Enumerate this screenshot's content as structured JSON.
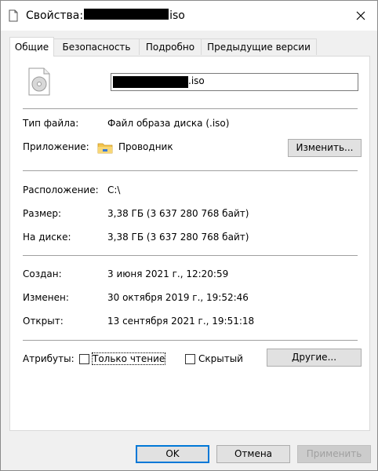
{
  "window": {
    "title_prefix": "Свойства:",
    "title_suffix": "iso"
  },
  "tabs": [
    {
      "label": "Общие",
      "active": true
    },
    {
      "label": "Безопасность",
      "active": false
    },
    {
      "label": "Подробно",
      "active": false
    },
    {
      "label": "Предыдущие версии",
      "active": false
    }
  ],
  "file": {
    "name_suffix": ".iso"
  },
  "info": {
    "type_label": "Тип файла:",
    "type_value": "Файл образа диска (.iso)",
    "app_label": "Приложение:",
    "app_value": "Проводник",
    "change_button": "Изменить...",
    "location_label": "Расположение:",
    "location_value": "C:\\",
    "size_label": "Размер:",
    "size_value": "3,38 ГБ (3 637 280 768 байт)",
    "disk_label": "На диске:",
    "disk_value": "3,38 ГБ (3 637 280 768 байт)",
    "created_label": "Создан:",
    "created_value": "3 июня 2021 г., 12:20:59",
    "modified_label": "Изменен:",
    "modified_value": "30 октября 2019 г., 19:52:46",
    "opened_label": "Открыт:",
    "opened_value": "13 сентября 2021 г., 19:51:18"
  },
  "attributes": {
    "label": "Атрибуты:",
    "readonly_label": "Только чтение",
    "readonly_checked": false,
    "hidden_label": "Скрытый",
    "hidden_checked": false,
    "other_button": "Другие..."
  },
  "footer": {
    "ok": "OK",
    "cancel": "Отмена",
    "apply": "Применить"
  }
}
